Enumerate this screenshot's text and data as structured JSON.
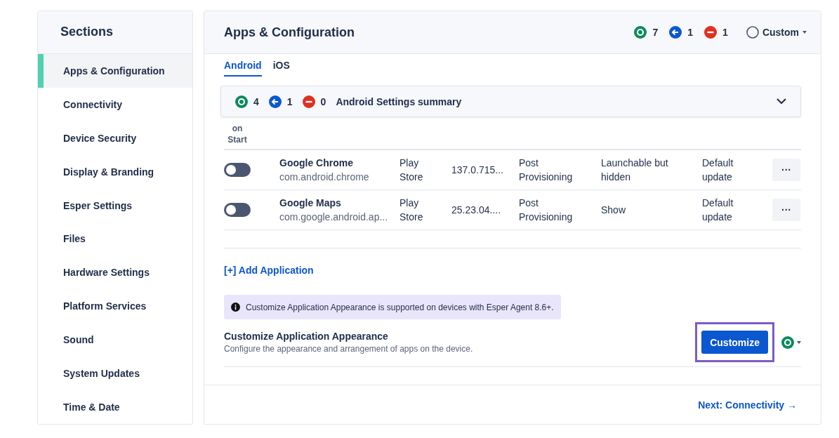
{
  "sidebar": {
    "title": "Sections",
    "items": [
      {
        "label": "Apps & Configuration",
        "selected": true
      },
      {
        "label": "Connectivity",
        "selected": false
      },
      {
        "label": "Device Security",
        "selected": false
      },
      {
        "label": "Display & Branding",
        "selected": false
      },
      {
        "label": "Esper Settings",
        "selected": false
      },
      {
        "label": "Files",
        "selected": false
      },
      {
        "label": "Hardware Settings",
        "selected": false
      },
      {
        "label": "Platform Services",
        "selected": false
      },
      {
        "label": "Sound",
        "selected": false
      },
      {
        "label": "System Updates",
        "selected": false
      },
      {
        "label": "Time & Date",
        "selected": false
      }
    ]
  },
  "header": {
    "title": "Apps & Configuration",
    "counts": [
      {
        "kind": "applied",
        "count": "7"
      },
      {
        "kind": "inherited",
        "count": "1"
      },
      {
        "kind": "blocked",
        "count": "1"
      }
    ],
    "mode": "Custom"
  },
  "tabs": [
    {
      "label": "Android",
      "selected": true
    },
    {
      "label": "iOS",
      "selected": false
    }
  ],
  "summary": {
    "counts": [
      {
        "kind": "applied",
        "count": "4"
      },
      {
        "kind": "inherited",
        "count": "1"
      },
      {
        "kind": "blocked",
        "count": "0"
      }
    ],
    "title": "Android Settings summary",
    "expanded": false
  },
  "table": {
    "column_1_header": [
      "on",
      "Start"
    ],
    "rows": [
      {
        "launch_on_start": false,
        "name": "Google Chrome",
        "package": "com.android.chrome",
        "type": "Play Store",
        "version": "137.0.715...",
        "installation": "Post Provisioning",
        "state": "Launchable but hidden",
        "update": "Default update",
        "actions": "···"
      },
      {
        "launch_on_start": false,
        "name": "Google Maps",
        "package": "com.google.android.ap...",
        "type": "Play Store",
        "version": "25.23.04....",
        "installation": "Post Provisioning",
        "state": "Show",
        "update": "Default update",
        "actions": "···"
      }
    ]
  },
  "add_link": "[+] Add Application",
  "notice": "Customize Application Appearance is supported on devices with Esper Agent 8.6+.",
  "customize": {
    "title": "Customize Application Appearance",
    "description": "Configure the appearance and arrangement of apps on the device.",
    "button": "Customize",
    "highlighted": true,
    "status": {
      "kind": "applied"
    }
  },
  "next_link": "Next: Connectivity →"
}
